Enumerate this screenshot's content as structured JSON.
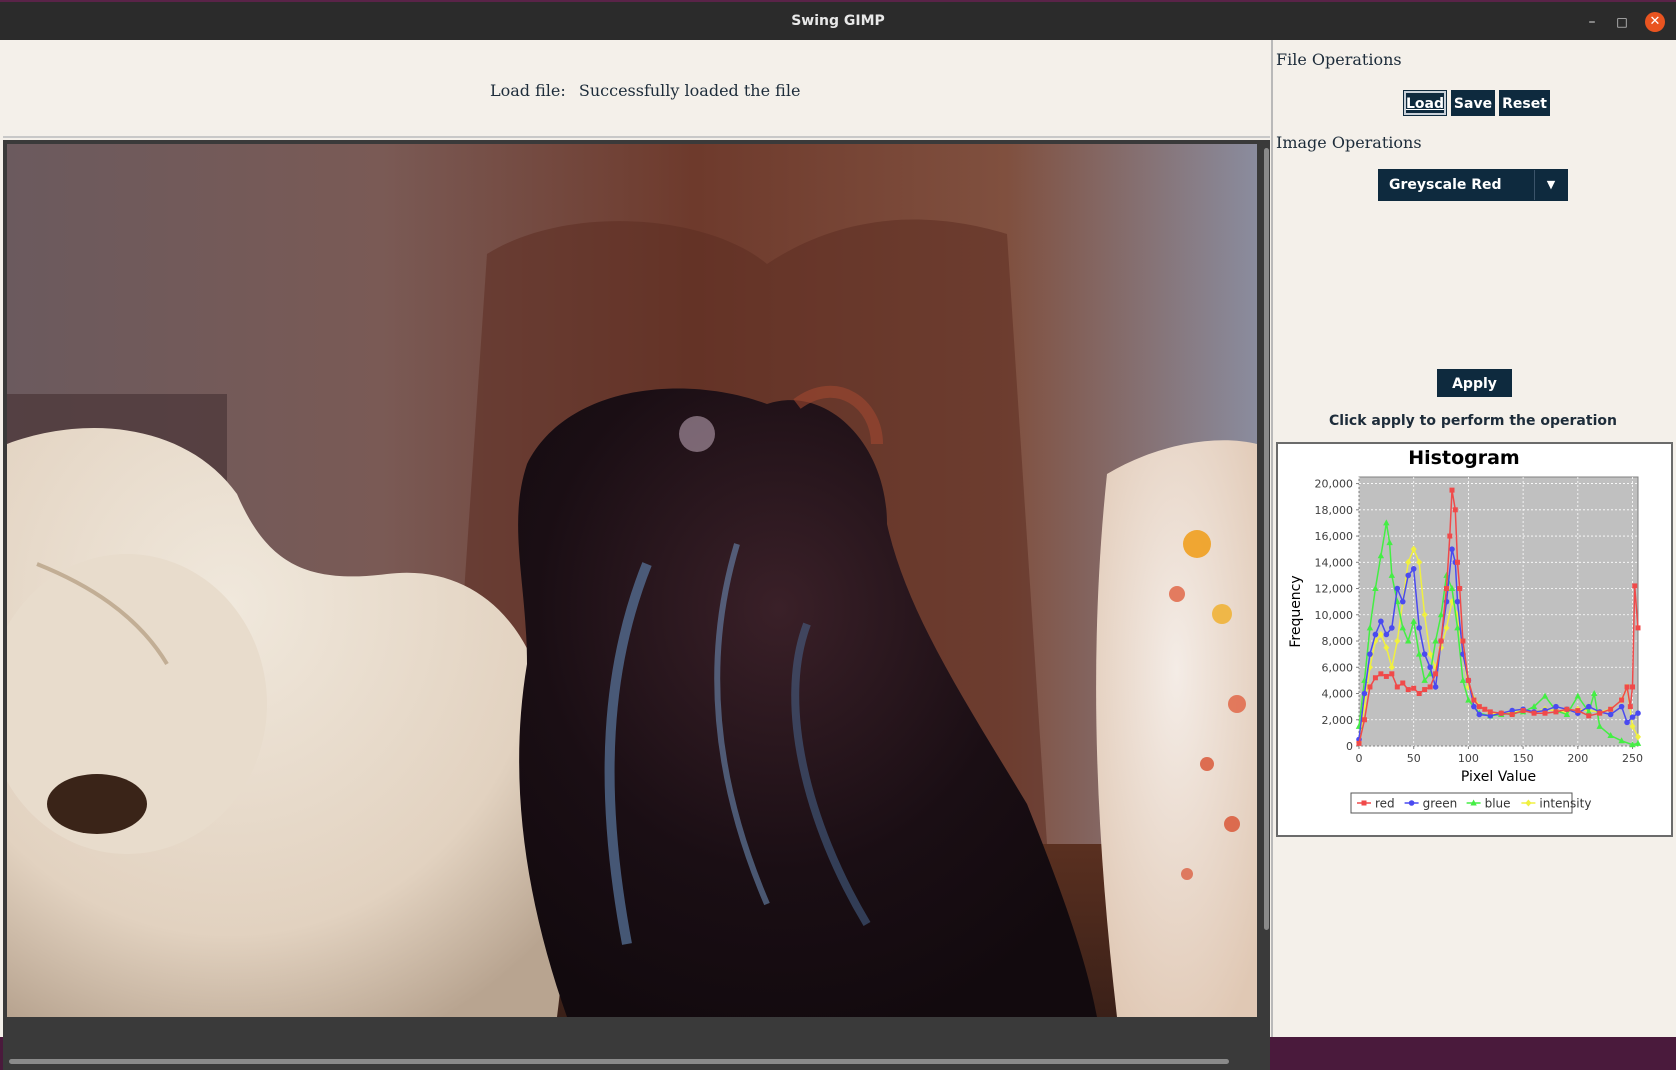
{
  "window": {
    "title": "Swing GIMP",
    "controls": {
      "minimize": "–",
      "maximize": "□",
      "close": "✕"
    }
  },
  "status": {
    "label": "Load file:",
    "message": "Successfully loaded the file"
  },
  "sidebar": {
    "file_ops_heading": "File Operations",
    "buttons": {
      "load": "Load",
      "save": "Save",
      "reset": "Reset"
    },
    "image_ops_heading": "Image Operations",
    "operation_select": {
      "value": "Greyscale Red",
      "icon": "chevron-down-icon"
    },
    "apply_label": "Apply",
    "hint": "Click apply to perform the operation"
  },
  "image": {
    "description": "photo-of-ceramic-figurines"
  },
  "colors": {
    "accent": "#0e2a3e",
    "panel_bg": "#f4f0ea",
    "red": "#f04a4a",
    "green": "#4a4af0",
    "blue": "#44ee44",
    "intensity": "#f0f040"
  },
  "chart_data": {
    "type": "line",
    "title": "Histogram",
    "xlabel": "Pixel Value",
    "ylabel": "Frequency",
    "xlim": [
      0,
      255
    ],
    "ylim": [
      0,
      20500
    ],
    "x_ticks": [
      0,
      50,
      100,
      150,
      200,
      250
    ],
    "y_ticks": [
      0,
      2000,
      4000,
      6000,
      8000,
      10000,
      12000,
      14000,
      16000,
      18000,
      20000
    ],
    "y_tick_labels": [
      "0",
      "2,000",
      "4,000",
      "6,000",
      "8,000",
      "10,000",
      "12,000",
      "14,000",
      "16,000",
      "18,000",
      "20,000"
    ],
    "x_tick_labels": [
      "0",
      "50",
      "100",
      "150",
      "200",
      "250"
    ],
    "grid": true,
    "legend_position": "bottom",
    "series": [
      {
        "name": "red",
        "color": "#f04a4a",
        "marker": "square",
        "x": [
          0,
          5,
          10,
          15,
          20,
          25,
          30,
          35,
          40,
          45,
          50,
          55,
          60,
          65,
          70,
          75,
          80,
          83,
          85,
          88,
          90,
          92,
          95,
          100,
          105,
          110,
          115,
          120,
          130,
          140,
          150,
          160,
          170,
          180,
          190,
          200,
          210,
          220,
          230,
          240,
          245,
          248,
          250,
          252,
          255
        ],
        "y": [
          200,
          2000,
          4500,
          5200,
          5500,
          5300,
          5500,
          4500,
          4800,
          4300,
          4400,
          4000,
          4300,
          4500,
          5500,
          8000,
          12000,
          16000,
          19500,
          18000,
          14000,
          12000,
          8000,
          5000,
          3500,
          3000,
          2800,
          2600,
          2500,
          2400,
          2700,
          2500,
          2500,
          2600,
          2800,
          2700,
          2300,
          2500,
          2800,
          3500,
          4500,
          3000,
          4500,
          12200,
          9000
        ]
      },
      {
        "name": "green",
        "color": "#4a4af0",
        "marker": "circle",
        "x": [
          0,
          5,
          10,
          15,
          20,
          25,
          30,
          35,
          40,
          45,
          50,
          55,
          60,
          65,
          70,
          75,
          80,
          85,
          88,
          90,
          95,
          100,
          105,
          110,
          120,
          130,
          140,
          150,
          160,
          170,
          180,
          190,
          200,
          210,
          220,
          230,
          240,
          245,
          250,
          255
        ],
        "y": [
          500,
          4000,
          7000,
          8500,
          9500,
          8500,
          9000,
          12000,
          11000,
          13000,
          13500,
          9000,
          7000,
          6000,
          4500,
          8000,
          11000,
          15000,
          14000,
          11000,
          7000,
          5000,
          3000,
          2400,
          2300,
          2500,
          2700,
          2800,
          2600,
          2700,
          3000,
          2800,
          2500,
          3000,
          2600,
          2400,
          3000,
          1800,
          2200,
          2500
        ]
      },
      {
        "name": "blue",
        "color": "#44ee44",
        "marker": "triangle",
        "x": [
          0,
          5,
          10,
          15,
          20,
          25,
          28,
          30,
          35,
          40,
          45,
          50,
          55,
          60,
          65,
          70,
          75,
          80,
          85,
          90,
          95,
          100,
          110,
          120,
          130,
          140,
          150,
          160,
          170,
          180,
          190,
          200,
          210,
          215,
          220,
          230,
          240,
          250,
          255
        ],
        "y": [
          1500,
          5000,
          9000,
          12000,
          14500,
          17000,
          15500,
          13000,
          11000,
          9000,
          8000,
          9500,
          7000,
          5000,
          5500,
          8000,
          10000,
          13000,
          12000,
          9000,
          5000,
          3500,
          2500,
          2300,
          2400,
          2500,
          2600,
          3000,
          3800,
          2700,
          2400,
          3800,
          2600,
          4000,
          1500,
          800,
          400,
          100,
          200
        ]
      },
      {
        "name": "intensity",
        "color": "#f0f040",
        "marker": "diamond",
        "x": [
          0,
          5,
          10,
          15,
          20,
          25,
          30,
          35,
          40,
          45,
          50,
          55,
          60,
          65,
          70,
          75,
          80,
          85,
          90,
          95,
          100,
          110,
          120,
          130,
          140,
          150,
          160,
          170,
          180,
          190,
          200,
          210,
          220,
          230,
          240,
          245,
          250,
          255
        ],
        "y": [
          300,
          3000,
          6000,
          8000,
          8500,
          7500,
          6000,
          8000,
          11000,
          14000,
          15000,
          14000,
          10000,
          7000,
          6000,
          7500,
          9000,
          11000,
          10000,
          7000,
          4500,
          3000,
          2500,
          2500,
          2600,
          2700,
          2600,
          2800,
          2700,
          2600,
          2800,
          2700,
          2600,
          2800,
          3500,
          4500,
          1500,
          700
        ]
      }
    ]
  }
}
